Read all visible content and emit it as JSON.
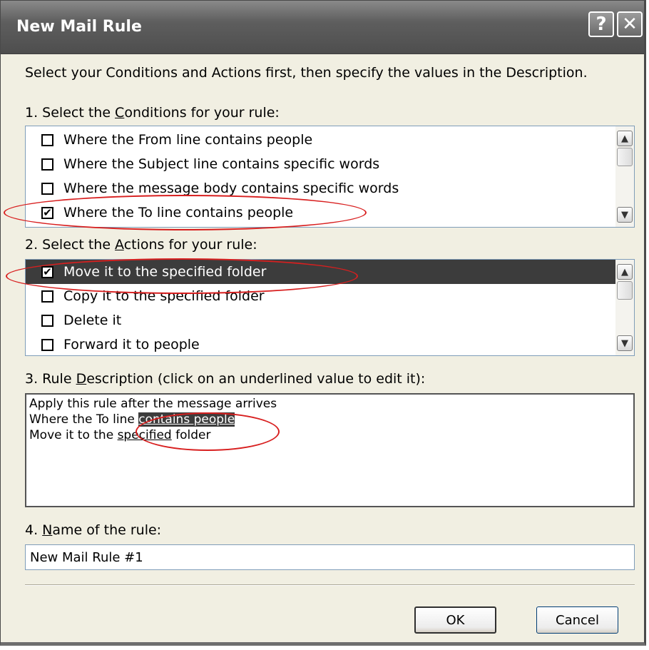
{
  "window": {
    "title": "New Mail Rule",
    "help_button": "?",
    "close_button": "✕"
  },
  "intro": "Select your Conditions and Actions first, then specify the values in the Description.",
  "conditions": {
    "label_pre": "1. Select the ",
    "label_u": "C",
    "label_post": "onditions for your rule:",
    "items": [
      {
        "label": "Where the From line contains people",
        "checked": false
      },
      {
        "label": "Where the Subject line contains specific words",
        "checked": false
      },
      {
        "label": "Where the message body contains specific words",
        "checked": false
      },
      {
        "label": "Where the To line contains people",
        "checked": true
      }
    ]
  },
  "actions": {
    "label_pre": "2. Select the ",
    "label_u": "A",
    "label_post": "ctions for your rule:",
    "items": [
      {
        "label": "Move it to the specified folder",
        "checked": true
      },
      {
        "label": "Copy it to the specified folder",
        "checked": false
      },
      {
        "label": "Delete it",
        "checked": false
      },
      {
        "label": "Forward it to people",
        "checked": false
      }
    ]
  },
  "description": {
    "label_pre": "3. Rule ",
    "label_u": "D",
    "label_post": "escription (click on an underlined value to edit it):",
    "line1": "Apply this rule after the message arrives",
    "line2_pre": "Where the To line ",
    "line2_link": "contains people",
    "line3_pre": "Move it to the ",
    "line3_link": "specified",
    "line3_post": " folder"
  },
  "name": {
    "label_pre": "4. ",
    "label_u": "N",
    "label_post": "ame of the rule:",
    "value": "New Mail Rule #1"
  },
  "buttons": {
    "ok": "OK",
    "cancel": "Cancel"
  },
  "scrollbar": {
    "up_icon": "▲",
    "down_icon": "▼"
  },
  "colors": {
    "annotation": "#d81f1f",
    "selection": "#3c3c3c"
  }
}
